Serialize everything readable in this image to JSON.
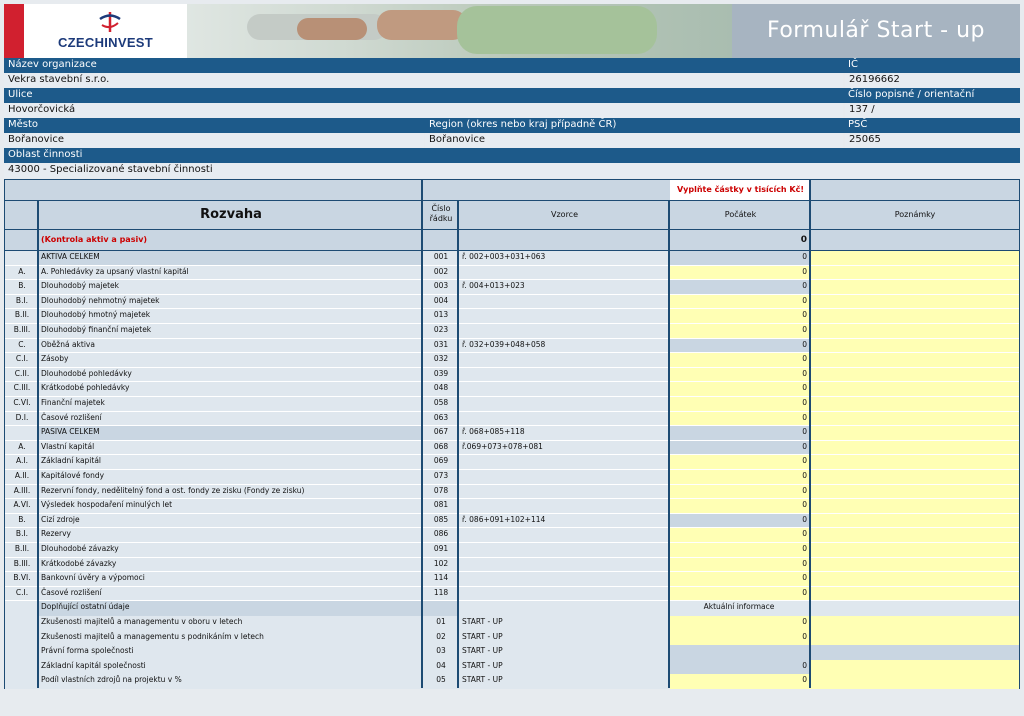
{
  "header": {
    "logo_text": "CZECHINVEST",
    "form_title": "Formulář Start - up"
  },
  "org": {
    "name_label": "Název organizace",
    "name_value": "Vekra stavební s.r.o.",
    "ic_label": "IČ",
    "ic_value": "26196662",
    "street_label": "Ulice",
    "street_value": "Hovorčovická",
    "number_label": "Číslo popisné / orientační",
    "number_value": "137 /",
    "city_label": "Město",
    "city_value": "Bořanovice",
    "region_label": "Region (okres nebo kraj případně ČR)",
    "region_value": "Bořanovice",
    "psc_label": "PSČ",
    "psc_value": "25065",
    "activity_label": "Oblast činnosti",
    "activity_value": "43000 - Specializované stavební činnosti"
  },
  "table": {
    "notice": "Vyplňte částky v tisících Kč!",
    "col_rozvaha": "Rozvaha",
    "col_cislo1": "Číslo",
    "col_cislo2": "řádku",
    "col_vzorce": "Vzorce",
    "col_pocatek": "Počátek",
    "col_poznamky": "Poznámky",
    "control_label": "(Kontrola aktiv a pasiv)",
    "control_value": "0",
    "rows": [
      {
        "code": "",
        "name": "AKTIVA CELKEM",
        "line": "001",
        "formula": "ř. 002+003+031+063",
        "value": "0",
        "kind": "total"
      },
      {
        "code": "A.",
        "name": "A. Pohledávky za upsaný vlastní kapitál",
        "line": "002",
        "formula": "",
        "value": "0",
        "kind": "input"
      },
      {
        "code": "B.",
        "name": "Dlouhodobý majetek",
        "line": "003",
        "formula": "ř. 004+013+023",
        "value": "0",
        "kind": "calc"
      },
      {
        "code": "B.I.",
        "name": "Dlouhodobý nehmotný majetek",
        "line": "004",
        "formula": "",
        "value": "0",
        "kind": "input"
      },
      {
        "code": "B.II.",
        "name": "Dlouhodobý hmotný majetek",
        "line": "013",
        "formula": "",
        "value": "0",
        "kind": "input"
      },
      {
        "code": "B.III.",
        "name": "Dlouhodobý finanční majetek",
        "line": "023",
        "formula": "",
        "value": "0",
        "kind": "input"
      },
      {
        "code": "C.",
        "name": "Oběžná aktiva",
        "line": "031",
        "formula": "ř. 032+039+048+058",
        "value": "0",
        "kind": "calc"
      },
      {
        "code": "C.I.",
        "name": "Zásoby",
        "line": "032",
        "formula": "",
        "value": "0",
        "kind": "input"
      },
      {
        "code": "C.II.",
        "name": "Dlouhodobé pohledávky",
        "line": "039",
        "formula": "",
        "value": "0",
        "kind": "input"
      },
      {
        "code": "C.III.",
        "name": "Krátkodobé pohledávky",
        "line": "048",
        "formula": "",
        "value": "0",
        "kind": "input"
      },
      {
        "code": "C.VI.",
        "name": "Finanční majetek",
        "line": "058",
        "formula": "",
        "value": "0",
        "kind": "input"
      },
      {
        "code": "D.I.",
        "name": "Časové rozlišení",
        "line": "063",
        "formula": "",
        "value": "0",
        "kind": "input"
      },
      {
        "code": "",
        "name": "PASIVA CELKEM",
        "line": "067",
        "formula": "ř. 068+085+118",
        "value": "0",
        "kind": "total"
      },
      {
        "code": "A.",
        "name": "Vlastní kapitál",
        "line": "068",
        "formula": "ř.069+073+078+081",
        "value": "0",
        "kind": "calc"
      },
      {
        "code": "A.I.",
        "name": "Základní kapitál",
        "line": "069",
        "formula": "",
        "value": "0",
        "kind": "input"
      },
      {
        "code": "A.II.",
        "name": "Kapitálové fondy",
        "line": "073",
        "formula": "",
        "value": "0",
        "kind": "input"
      },
      {
        "code": "A.III.",
        "name": "Rezervní fondy, nedělitelný fond a ost. fondy ze zisku (Fondy ze zisku)",
        "line": "078",
        "formula": "",
        "value": "0",
        "kind": "input"
      },
      {
        "code": "A.VI.",
        "name": "Výsledek hospodaření minulých let",
        "line": "081",
        "formula": "",
        "value": "0",
        "kind": "input"
      },
      {
        "code": "B.",
        "name": "Cizí zdroje",
        "line": "085",
        "formula": "ř. 086+091+102+114",
        "value": "0",
        "kind": "calc"
      },
      {
        "code": "B.I.",
        "name": "Rezervy",
        "line": "086",
        "formula": "",
        "value": "0",
        "kind": "input"
      },
      {
        "code": "B.II.",
        "name": "Dlouhodobé závazky",
        "line": "091",
        "formula": "",
        "value": "0",
        "kind": "input"
      },
      {
        "code": "B.III.",
        "name": "Krátkodobé závazky",
        "line": "102",
        "formula": "",
        "value": "0",
        "kind": "input"
      },
      {
        "code": "B.VI.",
        "name": "Bankovní úvěry a výpomoci",
        "line": "114",
        "formula": "",
        "value": "0",
        "kind": "input"
      },
      {
        "code": "C.I.",
        "name": "Časové rozlišení",
        "line": "118",
        "formula": "",
        "value": "0",
        "kind": "input"
      }
    ],
    "info_header_name": "Doplňující ostatní údaje",
    "info_header_title": "Aktuální informace",
    "info_rows": [
      {
        "name": "Zkušenosti majitelů a managementu v oboru v letech",
        "line": "01",
        "formula": "START - UP",
        "value": "0",
        "kind": "input"
      },
      {
        "name": "Zkušenosti majitelů a managementu s podnikáním v letech",
        "line": "02",
        "formula": "START - UP",
        "value": "0",
        "kind": "input"
      },
      {
        "name": "Právní forma společnosti",
        "line": "03",
        "formula": "START - UP",
        "value": "",
        "kind": "blank"
      },
      {
        "name": "Základní kapitál společnosti",
        "line": "04",
        "formula": "START - UP",
        "value": "0",
        "kind": "calc"
      },
      {
        "name": "Podíl vlastních zdrojů na projektu v %",
        "line": "05",
        "formula": "START - UP",
        "value": "0",
        "kind": "input"
      }
    ]
  },
  "colors": {
    "header_blue": "#1d5a8a",
    "input_yellow": "#ffffb4",
    "calc_grey": "#c9d6e2",
    "warning_red": "#cc0000"
  }
}
